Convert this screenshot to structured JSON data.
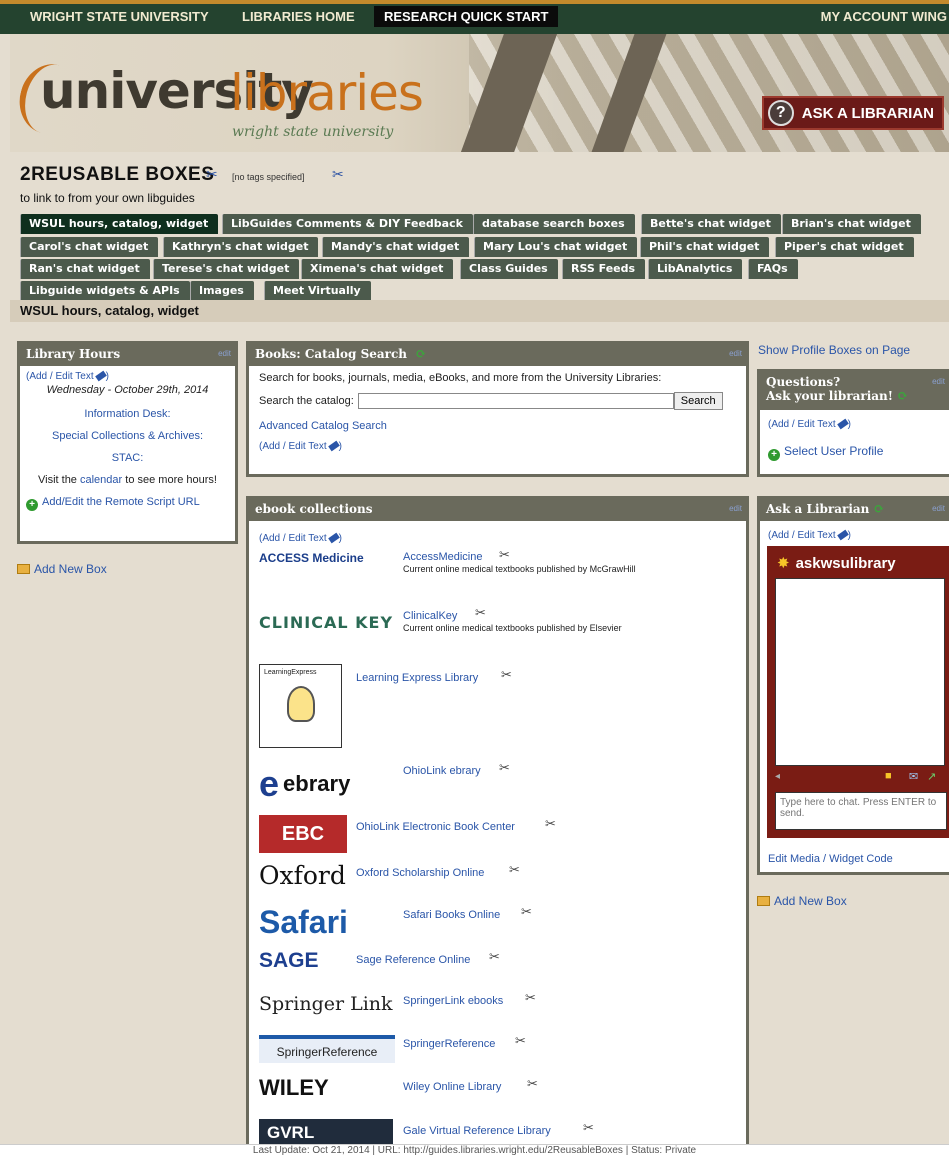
{
  "topnav": {
    "university": "WRIGHT STATE UNIVERSITY",
    "libraries_home": "LIBRARIES HOME",
    "research_quick_start": "RESEARCH QUICK START",
    "right": "MY ACCOUNT  WING"
  },
  "banner": {
    "logo_main": "university",
    "logo_libs": "libraries",
    "logo_sub": "wright state university",
    "ask_button": "ASK A LIBRARIAN",
    "ask_icon_glyph": "?"
  },
  "page": {
    "title": "2REUSABLE BOXES",
    "tags": "[no tags specified]",
    "subtitle": "to link to from your own libguides",
    "active_tab_heading": "WSUL hours, catalog, widget"
  },
  "tabs": [
    "WSUL hours, catalog, widget",
    "LibGuides Comments & DIY Feedback",
    "database search boxes",
    "Bette's chat widget",
    "Brian's chat widget",
    "Carol's chat widget",
    "Kathryn's chat widget",
    "Mandy's chat widget",
    "Mary Lou's chat widget",
    "Phil's chat widget",
    "Piper's chat widget",
    "Ran's chat widget",
    "Terese's chat widget",
    "Ximena's chat widget",
    "Class Guides",
    "RSS Feeds",
    "LibAnalytics",
    "FAQs",
    "Libguide widgets & APIs",
    "Images",
    "Meet Virtually"
  ],
  "library_hours": {
    "title": "Library Hours",
    "edit": "edit",
    "add_edit_text": "(Add / Edit Text",
    "date": "Wednesday - October 29th, 2014",
    "info_desk": "Information Desk:",
    "special": "Special Collections & Archives:",
    "stac": "STAC:",
    "visit_pre": "Visit the",
    "visit_link": "calendar",
    "visit_post": "to see more hours!",
    "remote_script": "Add/Edit the Remote Script URL"
  },
  "left_add_box": "Add New Box",
  "catalog": {
    "title": "Books: Catalog Search",
    "edit": "edit",
    "description": "Search for books, journals, media, eBooks, and more from the University Libraries:",
    "search_label": "Search the catalog:",
    "search_value": "",
    "search_button": "Search",
    "advanced": "Advanced Catalog Search",
    "add_edit_text": "(Add / Edit Text"
  },
  "ebooks": {
    "title": "ebook collections",
    "edit": "edit",
    "add_edit_text": "(Add / Edit Text",
    "items": [
      {
        "logo": "ACCESS Medicine",
        "link": "AccessMedicine",
        "desc": "Current online medical textbooks published by McGrawHill"
      },
      {
        "logo": "CLINICAL KEY",
        "link": "ClinicalKey",
        "desc": "Current online medical textbooks published by Elsevier"
      },
      {
        "logo": "LearningExpress",
        "link": "Learning Express Library",
        "desc": ""
      },
      {
        "logo": "ebrary",
        "link": "OhioLink ebrary",
        "desc": ""
      },
      {
        "logo": "EBC",
        "link": "OhioLink Electronic Book Center",
        "desc": ""
      },
      {
        "logo": "Oxford",
        "link": "Oxford Scholarship Online",
        "desc": ""
      },
      {
        "logo": "Safari",
        "link": "Safari Books Online",
        "desc": ""
      },
      {
        "logo": "SAGE",
        "link": "Sage Reference Online",
        "desc": ""
      },
      {
        "logo": "Springer Link",
        "link": "SpringerLink ebooks",
        "desc": ""
      },
      {
        "logo": "SpringerReference",
        "link": "SpringerReference",
        "desc": ""
      },
      {
        "logo": "WILEY",
        "link": "Wiley Online Library",
        "desc": ""
      },
      {
        "logo": "GVRL",
        "link": "Gale Virtual Reference Library",
        "desc": ""
      }
    ]
  },
  "right": {
    "show_profile": "Show Profile Boxes on Page",
    "questions_title": "Questions?",
    "questions_title2": "Ask your librarian!",
    "edit": "edit",
    "add_edit_text": "(Add / Edit Text",
    "select_profile": "Select User Profile",
    "ask_title": "Ask a Librarian",
    "chat_name": "askwsulibrary",
    "chat_placeholder": "Type here to chat. Press ENTER to send.",
    "edit_media": "Edit Media / Widget Code",
    "add_box": "Add New Box"
  },
  "footer": "Last Update: Oct 21, 2014  |  URL: http://guides.libraries.wright.edu/2ReusableBoxes  |  Status: Private",
  "colors": {
    "nav_bg": "#24432f",
    "tab_bg": "#4c5a4c",
    "tab_active": "#0f2f1e",
    "box_border": "#6a6a5c",
    "link": "#2a55a8",
    "accent_orange": "#c9711c",
    "chat_bg": "#7a1c14"
  }
}
